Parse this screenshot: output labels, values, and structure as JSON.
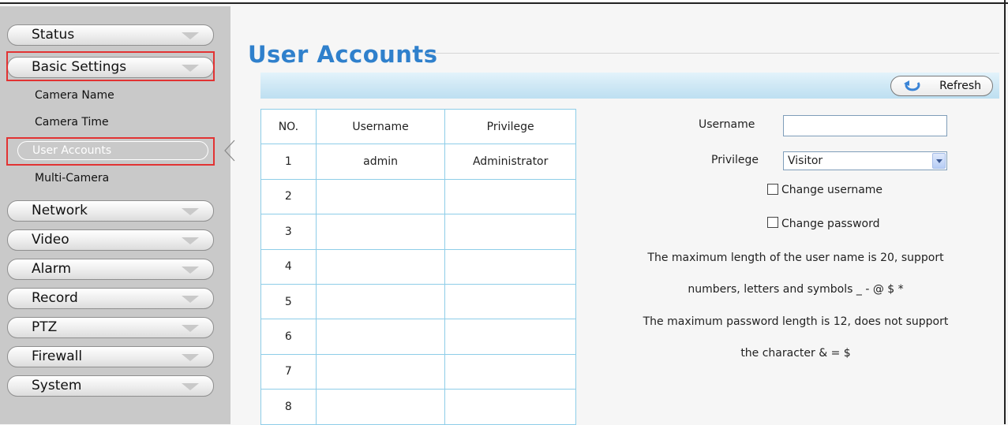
{
  "sidebar": {
    "menus": [
      {
        "label": "Status"
      },
      {
        "label": "Basic Settings"
      },
      {
        "label": "Network"
      },
      {
        "label": "Video"
      },
      {
        "label": "Alarm"
      },
      {
        "label": "Record"
      },
      {
        "label": "PTZ"
      },
      {
        "label": "Firewall"
      },
      {
        "label": "System"
      }
    ],
    "submenu": [
      {
        "label": "Camera Name"
      },
      {
        "label": "Camera Time"
      },
      {
        "label": "User Accounts"
      },
      {
        "label": "Multi-Camera"
      }
    ],
    "highlight_color": "#e23333"
  },
  "main": {
    "title": "User Accounts",
    "refresh_label": "Refresh",
    "table": {
      "headers": [
        "NO.",
        "Username",
        "Privilege"
      ],
      "rows": [
        {
          "no": "1",
          "username": "admin",
          "privilege": "Administrator"
        },
        {
          "no": "2",
          "username": "",
          "privilege": ""
        },
        {
          "no": "3",
          "username": "",
          "privilege": ""
        },
        {
          "no": "4",
          "username": "",
          "privilege": ""
        },
        {
          "no": "5",
          "username": "",
          "privilege": ""
        },
        {
          "no": "6",
          "username": "",
          "privilege": ""
        },
        {
          "no": "7",
          "username": "",
          "privilege": ""
        },
        {
          "no": "8",
          "username": "",
          "privilege": ""
        }
      ]
    },
    "form": {
      "username_label": "Username",
      "username_value": "",
      "privilege_label": "Privilege",
      "privilege_value": "Visitor",
      "change_username_label": "Change username",
      "change_password_label": "Change password",
      "info_1": "The maximum length of the user name is 20, support",
      "info_2": "numbers, letters and symbols _ - @ $ *",
      "info_3": "The maximum password length is 12, does not support",
      "info_4": "the character & = $"
    },
    "accent_color": "#2f80cc"
  }
}
